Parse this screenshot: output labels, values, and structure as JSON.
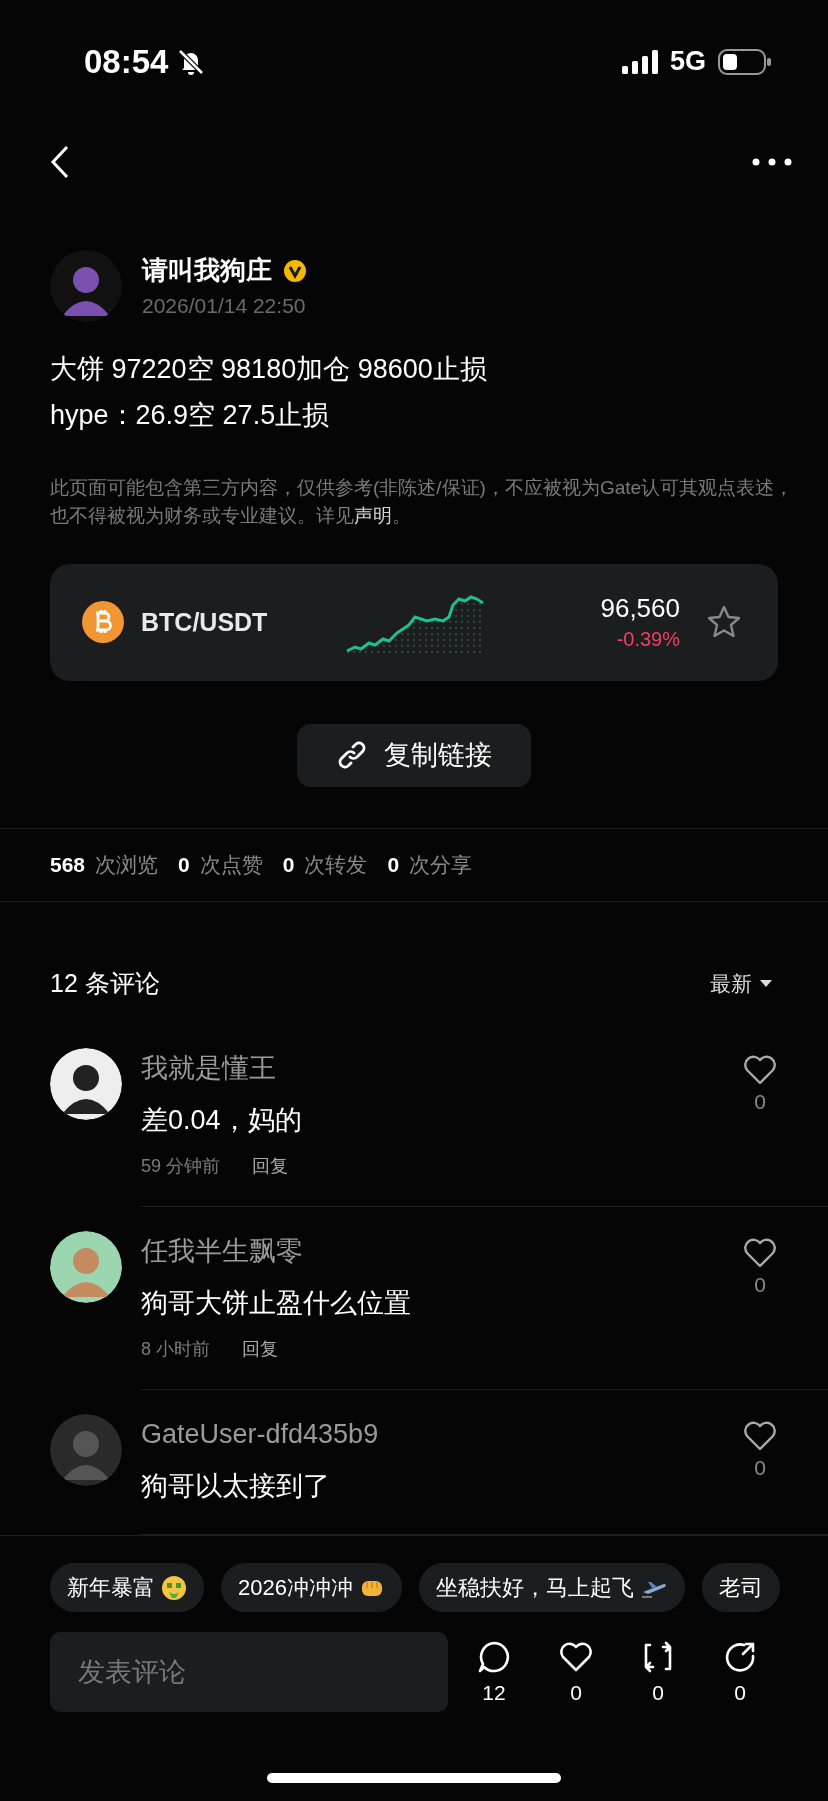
{
  "status_bar": {
    "time": "08:54",
    "silent": true,
    "network": "5G"
  },
  "author": {
    "name": "请叫我狗庄",
    "verified": true,
    "time": "2026/01/14 22:50"
  },
  "post": {
    "lines": [
      "大饼 97220空  98180加仓 98600止损",
      "hype：26.9空 27.5止损"
    ]
  },
  "disclaimer": {
    "text": "此页面可能包含第三方内容，仅供参考(非陈述/保证)，不应被视为Gate认可其观点表述，也不得被视为财务或专业建议。详见",
    "link": "声明",
    "end": "。"
  },
  "ticker": {
    "pair": "BTC/USDT",
    "price": "96,560",
    "change": "-0.39%",
    "favorite": false
  },
  "copy_button": {
    "label": "复制链接"
  },
  "stats": [
    {
      "count": "568",
      "label": "次浏览"
    },
    {
      "count": "0",
      "label": "次点赞"
    },
    {
      "count": "0",
      "label": "次转发"
    },
    {
      "count": "0",
      "label": "次分享"
    }
  ],
  "comments_header": {
    "title": "12 条评论",
    "sort": "最新"
  },
  "comments": [
    {
      "user": "我就是懂王",
      "text": "差0.04，妈的",
      "time": "59 分钟前",
      "reply": "回复",
      "likes": "0",
      "liked": false
    },
    {
      "user": "任我半生飘零",
      "text": "狗哥大饼止盈什么位置",
      "time": "8 小时前",
      "reply": "回复",
      "likes": "0",
      "liked": false
    },
    {
      "user": "GateUser-dfd435b9",
      "text": "狗哥以太接到了",
      "likes": "0",
      "liked": false
    }
  ],
  "quick_replies": [
    {
      "text": "新年暴富",
      "kind": "money"
    },
    {
      "text": "2026冲冲冲",
      "kind": "fist"
    },
    {
      "text": "坐稳扶好，马上起飞",
      "kind": "plane"
    },
    {
      "text": "老司",
      "kind": "plain"
    }
  ],
  "composer": {
    "placeholder": "发表评论"
  },
  "actions": [
    {
      "kind": "comment",
      "count": "12"
    },
    {
      "kind": "like",
      "count": "0"
    },
    {
      "kind": "repost",
      "count": "0"
    },
    {
      "kind": "share",
      "count": "0"
    }
  ]
}
